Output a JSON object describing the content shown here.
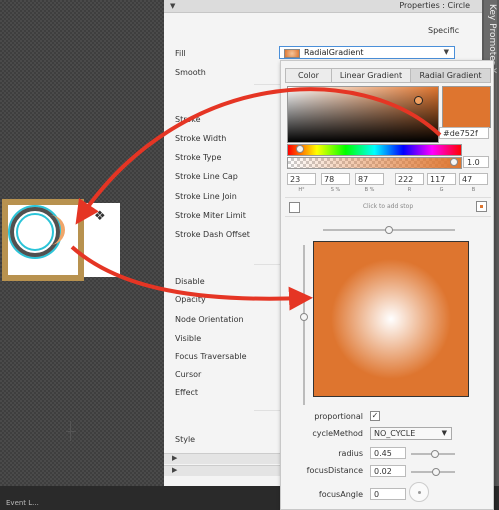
{
  "colors": {
    "accent": "#de752f",
    "arrow": "#e53524",
    "panel": "#f4f4f4",
    "selection": "#4a8fd9"
  },
  "bottom_bar": {
    "text": "Event L..."
  },
  "canvas": {
    "icon": "grip-icon"
  },
  "properties": {
    "title": "Properties : Circle",
    "section": "Specific",
    "rows": {
      "fill": "Fill",
      "smooth": "Smooth",
      "stroke": "Stroke",
      "stroke_width": "Stroke Width",
      "stroke_type": "Stroke Type",
      "stroke_line_cap": "Stroke Line Cap",
      "stroke_line_join": "Stroke Line Join",
      "stroke_miter_limit": "Stroke Miter Limit",
      "stroke_dash_offset": "Stroke Dash Offset",
      "disable": "Disable",
      "opacity": "Opacity",
      "node_orientation": "Node Orientation",
      "visible": "Visible",
      "focus_traversable": "Focus Traversable",
      "cursor": "Cursor",
      "effect": "Effect",
      "style": "Style"
    },
    "fill_value": "RadialGradient"
  },
  "side_tab": {
    "label": "Key Promoter X"
  },
  "picker": {
    "tabs": [
      "Color",
      "Linear Gradient",
      "Radial Gradient"
    ],
    "active_tab": "Radial Gradient",
    "hex": "#de752f",
    "alpha": "1.0",
    "values": [
      {
        "label": "H°",
        "value": "23"
      },
      {
        "label": "S %",
        "value": "78"
      },
      {
        "label": "B %",
        "value": "87"
      },
      {
        "label": "R",
        "value": "222"
      },
      {
        "label": "G",
        "value": "117"
      },
      {
        "label": "B",
        "value": "47"
      }
    ],
    "stop_hint": "Click to add stop",
    "proportional_label": "proportional",
    "proportional_checked": "✓",
    "cycle_label": "cycleMethod",
    "cycle_value": "NO_CYCLE",
    "radius_label": "radius",
    "radius_value": "0.45",
    "focus_distance_label": "focusDistance",
    "focus_distance_value": "0.02",
    "focus_angle_label": "focusAngle",
    "focus_angle_value": "0"
  }
}
